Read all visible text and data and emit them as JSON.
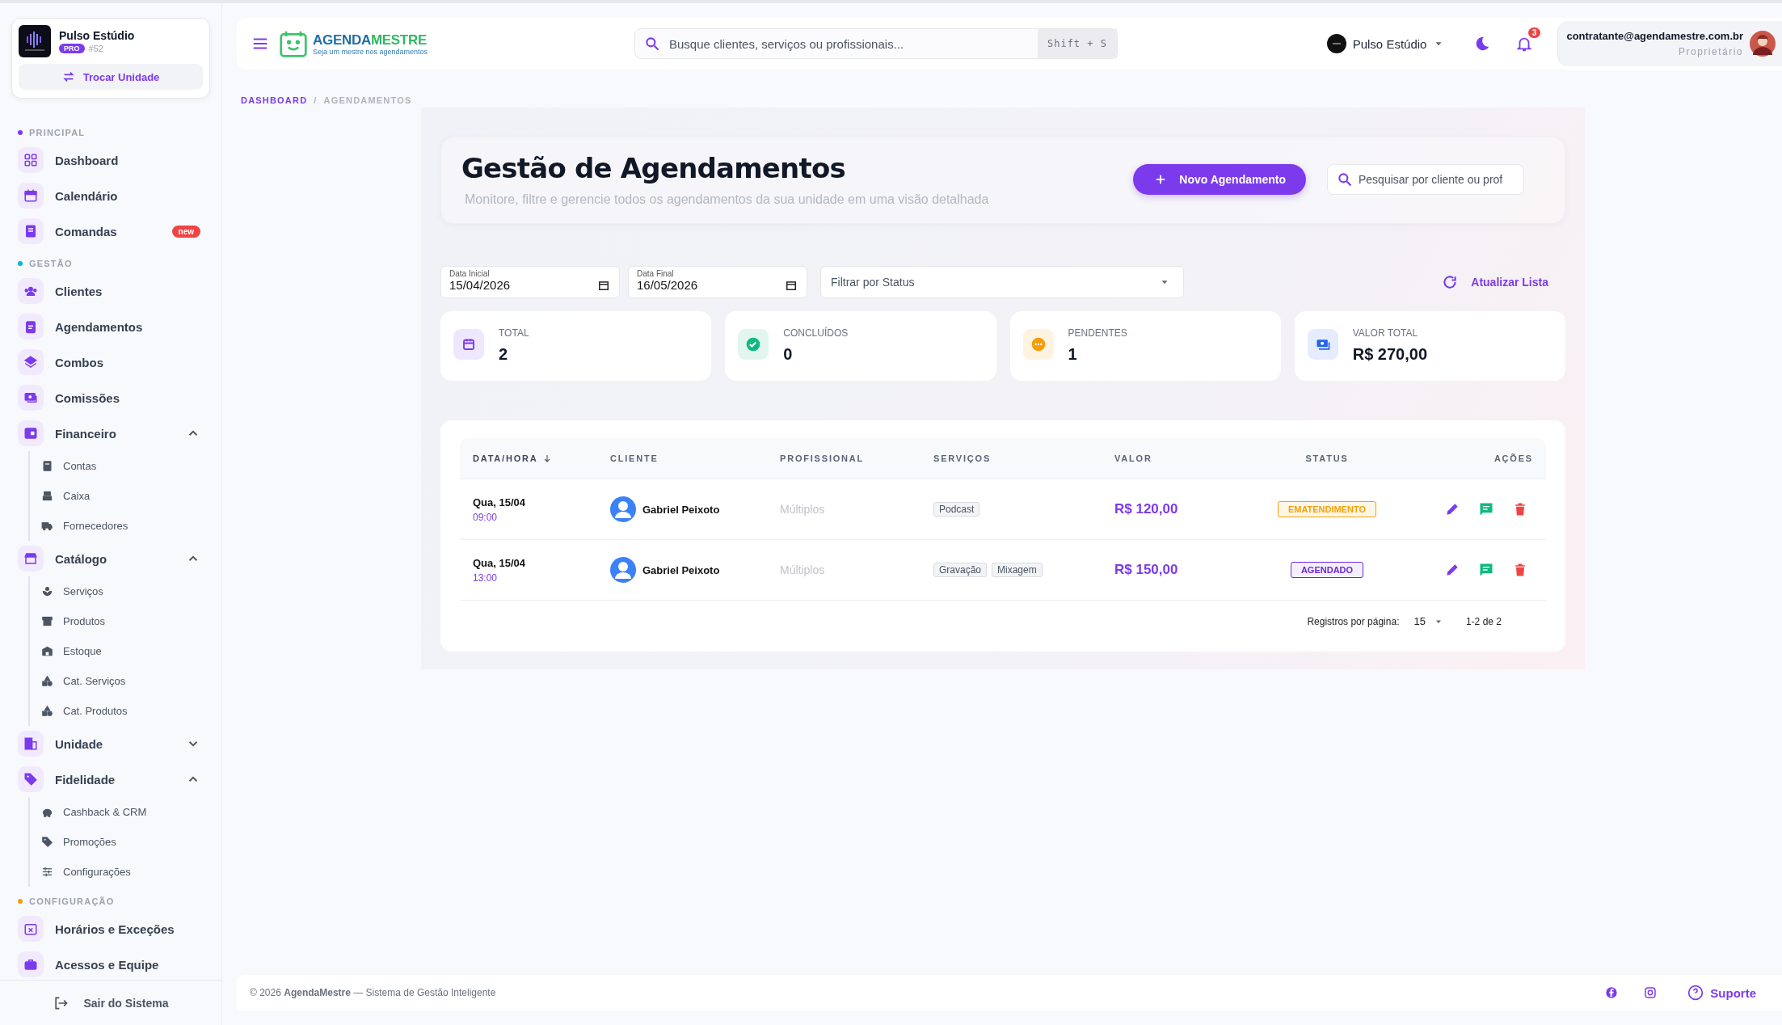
{
  "sidebar": {
    "unit": {
      "name": "Pulso Estúdio",
      "plan": "PRO",
      "number": "#52",
      "switch_label": "Trocar Unidade"
    },
    "sections": [
      {
        "title": "PRINCIPAL",
        "color": "#7c3aed",
        "items": [
          {
            "label": "Dashboard"
          },
          {
            "label": "Calendário"
          },
          {
            "label": "Comandas",
            "badge": "new"
          }
        ]
      },
      {
        "title": "GESTÃO",
        "color": "#06b6d4",
        "items": [
          {
            "label": "Clientes"
          },
          {
            "label": "Agendamentos"
          },
          {
            "label": "Combos"
          },
          {
            "label": "Comissões"
          },
          {
            "label": "Financeiro",
            "expanded": true,
            "children": [
              {
                "label": "Contas"
              },
              {
                "label": "Caixa"
              },
              {
                "label": "Fornecedores"
              }
            ]
          },
          {
            "label": "Catálogo",
            "expanded": true,
            "children": [
              {
                "label": "Serviços"
              },
              {
                "label": "Produtos"
              },
              {
                "label": "Estoque"
              },
              {
                "label": "Cat. Serviços"
              },
              {
                "label": "Cat. Produtos"
              }
            ]
          },
          {
            "label": "Unidade",
            "expanded": false
          },
          {
            "label": "Fidelidade",
            "expanded": true,
            "children": [
              {
                "label": "Cashback & CRM"
              },
              {
                "label": "Promoções"
              },
              {
                "label": "Configurações"
              }
            ]
          }
        ]
      },
      {
        "title": "CONFIGURAÇÃO",
        "color": "#f59e0b",
        "items": [
          {
            "label": "Horários e Exceções"
          },
          {
            "label": "Acessos e Equipe"
          }
        ]
      }
    ],
    "logout": "Sair do Sistema"
  },
  "header": {
    "brand_first": "AGENDA",
    "brand_second": "MESTRE",
    "tagline": "Seja um mestre nos agendamentos",
    "search": {
      "placeholder": "Busque clientes, serviços ou profissionais...",
      "shortcut": "Shift + S"
    },
    "unit_selector": "Pulso Estúdio",
    "notifications": "3",
    "user": {
      "email": "contratante@agendamestre.com.br",
      "role": "Proprietário"
    }
  },
  "breadcrumb": {
    "separator": "/",
    "items": [
      "DASHBOARD",
      "AGENDAMENTOS"
    ]
  },
  "page": {
    "title": "Gestão de Agendamentos",
    "subtitle": "Monitore, filtre e gerencie todos os agendamentos da sua unidade em uma visão detalhada",
    "new_button": "Novo Agendamento",
    "search": {
      "placeholder": "Pesquisar por cliente ou prof"
    }
  },
  "filters": {
    "start": {
      "label": "Data Inicial",
      "value": "15/04/2026"
    },
    "end": {
      "label": "Data Final",
      "value": "16/05/2026"
    },
    "status": {
      "placeholder": "Filtrar por Status"
    },
    "refresh": "Atualizar Lista"
  },
  "stats": [
    {
      "label": "TOTAL",
      "value": "2",
      "color": "#7c3aed"
    },
    {
      "label": "CONCLUÍDOS",
      "value": "0",
      "color": "#10b981"
    },
    {
      "label": "PENDENTES",
      "value": "1",
      "color": "#f59e0b"
    },
    {
      "label": "VALOR TOTAL",
      "value": "R$ 270,00",
      "color": "#2563eb"
    }
  ],
  "table": {
    "columns": [
      {
        "label": "DATA/HORA",
        "sorted": true
      },
      {
        "label": "CLIENTE",
        "sorted": false
      },
      {
        "label": "PROFISSIONAL",
        "sorted": false
      },
      {
        "label": "SERVIÇOS",
        "sorted": false
      },
      {
        "label": "VALOR",
        "sorted": false
      },
      {
        "label": "STATUS",
        "sorted": false
      },
      {
        "label": "AÇÕES",
        "sorted": false
      }
    ],
    "rows": [
      {
        "date": "Qua, 15/04",
        "time": "09:00",
        "client": "Gabriel Peixoto",
        "professional": "Múltiplos",
        "services": [
          "Podcast"
        ],
        "value": "R$ 120,00",
        "status": {
          "label": "EMATENDIMENTO",
          "kind": "in_progress"
        }
      },
      {
        "date": "Qua, 15/04",
        "time": "13:00",
        "client": "Gabriel Peixoto",
        "professional": "Múltiplos",
        "services": [
          "Gravação",
          "Mixagem"
        ],
        "value": "R$ 150,00",
        "status": {
          "label": "AGENDADO",
          "kind": "scheduled"
        }
      }
    ],
    "pagination": {
      "label": "Registros por página:",
      "per_page": "15",
      "range": "1-2 de 2"
    }
  },
  "footer": {
    "text": "© 2026 **AgendaMestre** — Sistema de Gestão Inteligente",
    "support": "Suporte"
  }
}
